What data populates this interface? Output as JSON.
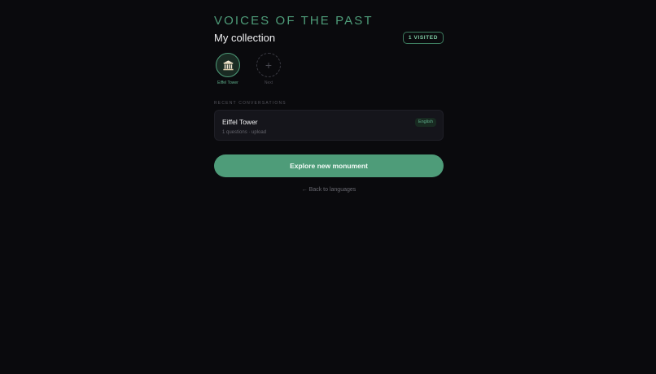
{
  "brand": "VOICES OF THE PAST",
  "title": "My collection",
  "badge": "1 VISITED",
  "stamps": [
    {
      "label": "Eiffel Tower",
      "icon": "monument-icon",
      "visited": true
    },
    {
      "label": "Next",
      "icon": "plus-icon",
      "visited": false
    }
  ],
  "section_label": "RECENT CONVERSATIONS",
  "conversations": [
    {
      "title": "Eiffel Tower",
      "meta": "1 questions · upload",
      "language": "English"
    }
  ],
  "cta_label": "Explore new monument",
  "back_label": "← Back to languages",
  "colors": {
    "accent": "#4e9c79",
    "background": "#0a0a0d",
    "card": "#15151b"
  }
}
